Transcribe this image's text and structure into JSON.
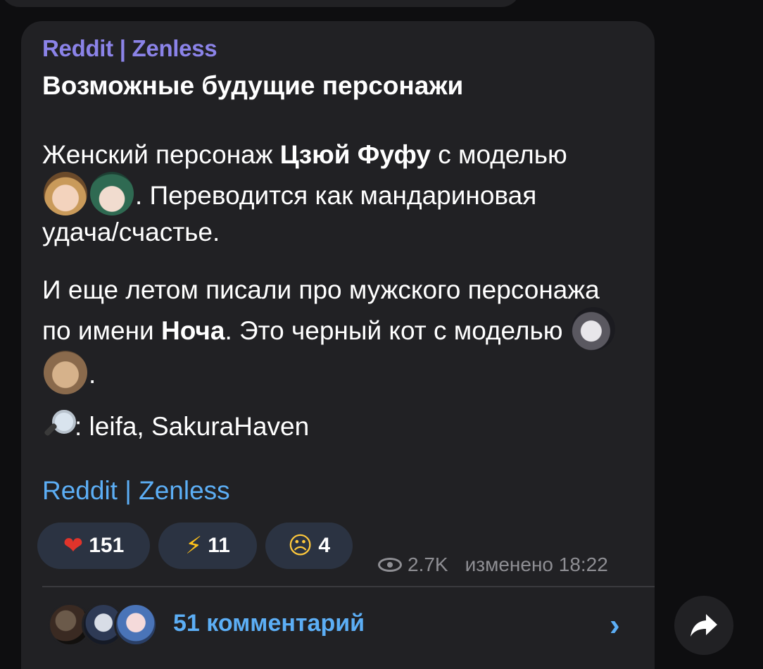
{
  "post": {
    "sender": "Reddit | Zenless",
    "title": "Возможные будущие персонажи",
    "p1": {
      "t1": "Женский персонаж ",
      "b1": "Цзюй Фуфу",
      "t2": " с моделью ",
      "t3": ". Переводится как мандариновая удача/счастье."
    },
    "p2": {
      "t1": "И еще летом писали про мужского персонажа по имени ",
      "b1": "Ноча",
      "t2": ". Это черный кот с моделью ",
      "t3": "."
    },
    "p3": {
      "t1": ": leifa, SakuraHaven"
    },
    "link": "Reddit | Zenless",
    "emoji_icons": [
      "character-avatar-emoji",
      "character-avatar-emoji",
      "character-avatar-emoji",
      "character-avatar-emoji",
      "magnifying-glass-icon"
    ]
  },
  "reactions": [
    {
      "emoji": "heart-on-fire-icon",
      "glyph": "❤",
      "count": "151"
    },
    {
      "emoji": "lightning-icon",
      "glyph": "⚡",
      "count": "11"
    },
    {
      "emoji": "crying-face-icon",
      "glyph": "☹",
      "count": "4"
    }
  ],
  "meta": {
    "views": "2.7K",
    "edited": "изменено 18:22"
  },
  "comments": {
    "label": "51 комментарий",
    "arrow_glyph": "›"
  },
  "colors": {
    "bubble": "#212124",
    "accent_link": "#5caef5",
    "sender": "#8b83e8",
    "reaction_bg": "#2b3342"
  }
}
